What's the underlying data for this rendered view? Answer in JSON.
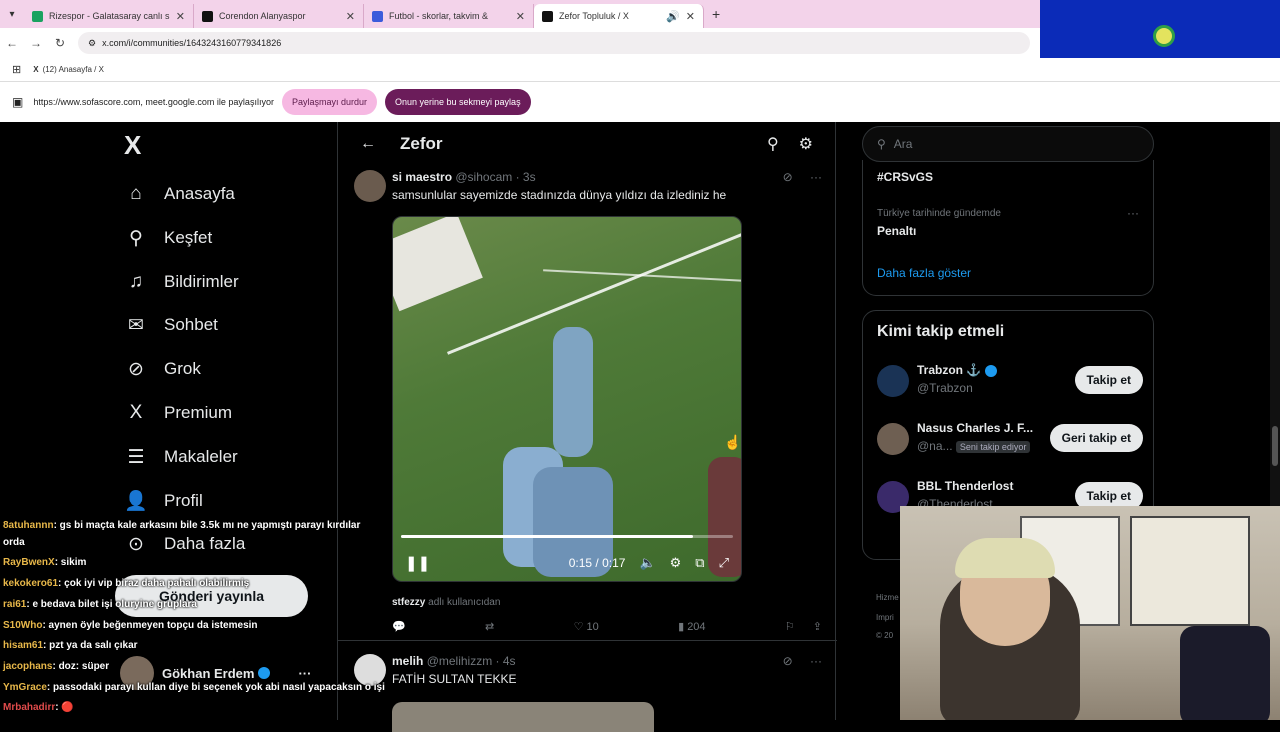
{
  "browser": {
    "tabs": [
      {
        "title": "Rizespor - Galatasaray canlı skor",
        "color": "#1aa260"
      },
      {
        "title": "Corendon Alanyaspor",
        "color": "#111111"
      },
      {
        "title": "Futbol - skorlar, takvim &",
        "color": "#3b5bdb"
      },
      {
        "title": "Zefor Topluluk / X",
        "color": "#111111"
      }
    ],
    "url": "x.com/i/communities/1643243160779341826",
    "bookmark": "(12) Anasayfa / X",
    "share_text": "https://www.sofascore.com, meet.google.com ile paylaşılıyor",
    "stop_share": "Paylaşmayı durdur",
    "share_this": "Onun yerine bu sekmeyi paylaş"
  },
  "nav": {
    "logo": "X",
    "items": [
      {
        "label": "Anasayfa",
        "icon": "⌂"
      },
      {
        "label": "Keşfet",
        "icon": "⚲"
      },
      {
        "label": "Bildirimler",
        "icon": "♫"
      },
      {
        "label": "Sohbet",
        "icon": "✉"
      },
      {
        "label": "Grok",
        "icon": "⊘"
      },
      {
        "label": "Premium",
        "icon": "X"
      },
      {
        "label": "Makaleler",
        "icon": "☰"
      },
      {
        "label": "Profil",
        "icon": "👤"
      },
      {
        "label": "Daha fazla",
        "icon": "⊙"
      }
    ],
    "post_label": "Gönderi yayınla",
    "profile_name": "Gökhan Erdem"
  },
  "community": {
    "title": "Zefor",
    "tweets": [
      {
        "name": "si maestro",
        "handle": "@sihocam · 3s",
        "text": "samsunlular sayemizde stadınızda dünya yıldızı da izlediniz he",
        "credit": "stfezzy",
        "credit_suffix": "adlı kullanıcıdan",
        "replies": "",
        "retweets": "",
        "likes": "10",
        "views": "204"
      },
      {
        "name": "melih",
        "handle": "@melihizzm · 4s",
        "text": "FATİH SULTAN TEKKE"
      }
    ],
    "video": {
      "time": "0:15 / 0:17",
      "progress": 0.88
    }
  },
  "sidebar": {
    "search_placeholder": "Ara",
    "trend1": "#CRSvGS",
    "trend2_context": "Türkiye tarihinde gündemde",
    "trend2": "Penaltı",
    "show_more": "Daha fazla göster",
    "follow_title": "Kimi takip etmeli",
    "follow": [
      {
        "name": "Trabzon ⚓",
        "handle": "@Trabzon",
        "button": "Takip et",
        "note": ""
      },
      {
        "name": "Nasus Charles J. F...",
        "handle": "@na...",
        "button": "Geri takip et",
        "note": "Seni takip ediyor"
      },
      {
        "name": "BBL Thenderlost",
        "handle": "@Thenderlost",
        "button": "Takip et",
        "note": ""
      }
    ],
    "footer1": "Hizme",
    "footer2": "Impri",
    "footer3": "© 20"
  },
  "chat": [
    {
      "user": "8atuhannn",
      "msg": ": gs bi maçta kale arkasını bile 3.5k mı ne yapmıştı parayı kırdılar"
    },
    {
      "user": "",
      "msg": "orda"
    },
    {
      "user": "RayBwenX",
      "msg": ": sikim"
    },
    {
      "user": "kekokero61",
      "msg": ": çok iyi vip biraz daha pahalı olabilirmiş"
    },
    {
      "user": "rai61",
      "msg": ": e bedava bilet işi oluryine gruplara"
    },
    {
      "user": "S10Who",
      "msg": ": aynen öyle beğenmeyen topçu da istemesin"
    },
    {
      "user": "hisam61",
      "msg": ": pzt ya da salı çıkar"
    },
    {
      "user": "jacophans",
      "msg": ": doz: süper"
    },
    {
      "user": "YmGrace",
      "msg": ": passodaki parayı kullan diye bi seçenek yok abi nasıl yapacaksın o işi"
    },
    {
      "user": "Mrbahadirr",
      "msg": ": 🔴"
    }
  ]
}
